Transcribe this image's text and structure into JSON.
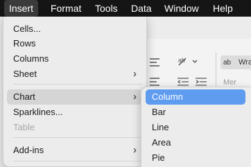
{
  "menubar": {
    "items": [
      "Insert",
      "Format",
      "Tools",
      "Data",
      "Window",
      "Help"
    ],
    "active": "Insert"
  },
  "insert_menu": {
    "items": [
      {
        "label": "Cells...",
        "submenu": false,
        "disabled": false
      },
      {
        "label": "Rows",
        "submenu": false,
        "disabled": false
      },
      {
        "label": "Columns",
        "submenu": false,
        "disabled": false
      },
      {
        "label": "Sheet",
        "submenu": true,
        "disabled": false
      },
      {
        "label": "Chart",
        "submenu": true,
        "disabled": false,
        "highlighted": true
      },
      {
        "label": "Sparklines...",
        "submenu": false,
        "disabled": false
      },
      {
        "label": "Table",
        "submenu": false,
        "disabled": true
      },
      {
        "label": "Add-ins",
        "submenu": true,
        "disabled": false
      }
    ],
    "submenu_arrow": "›"
  },
  "chart_submenu": {
    "items": [
      "Column",
      "Bar",
      "Line",
      "Area",
      "Pie"
    ],
    "selected": "Column"
  },
  "background": {
    "wrap_label": "Wra",
    "wrap_icon_text": "ab",
    "partial_text": "Mer",
    "icons": [
      "align-icon",
      "text-direction-icon",
      "indent-decrease-icon",
      "indent-increase-icon"
    ]
  },
  "colors": {
    "menubar_bg": "#151515",
    "menu_bg": "#ececec",
    "highlight_gray": "#d5d5d5",
    "selection_blue": "#5f9cf0"
  }
}
